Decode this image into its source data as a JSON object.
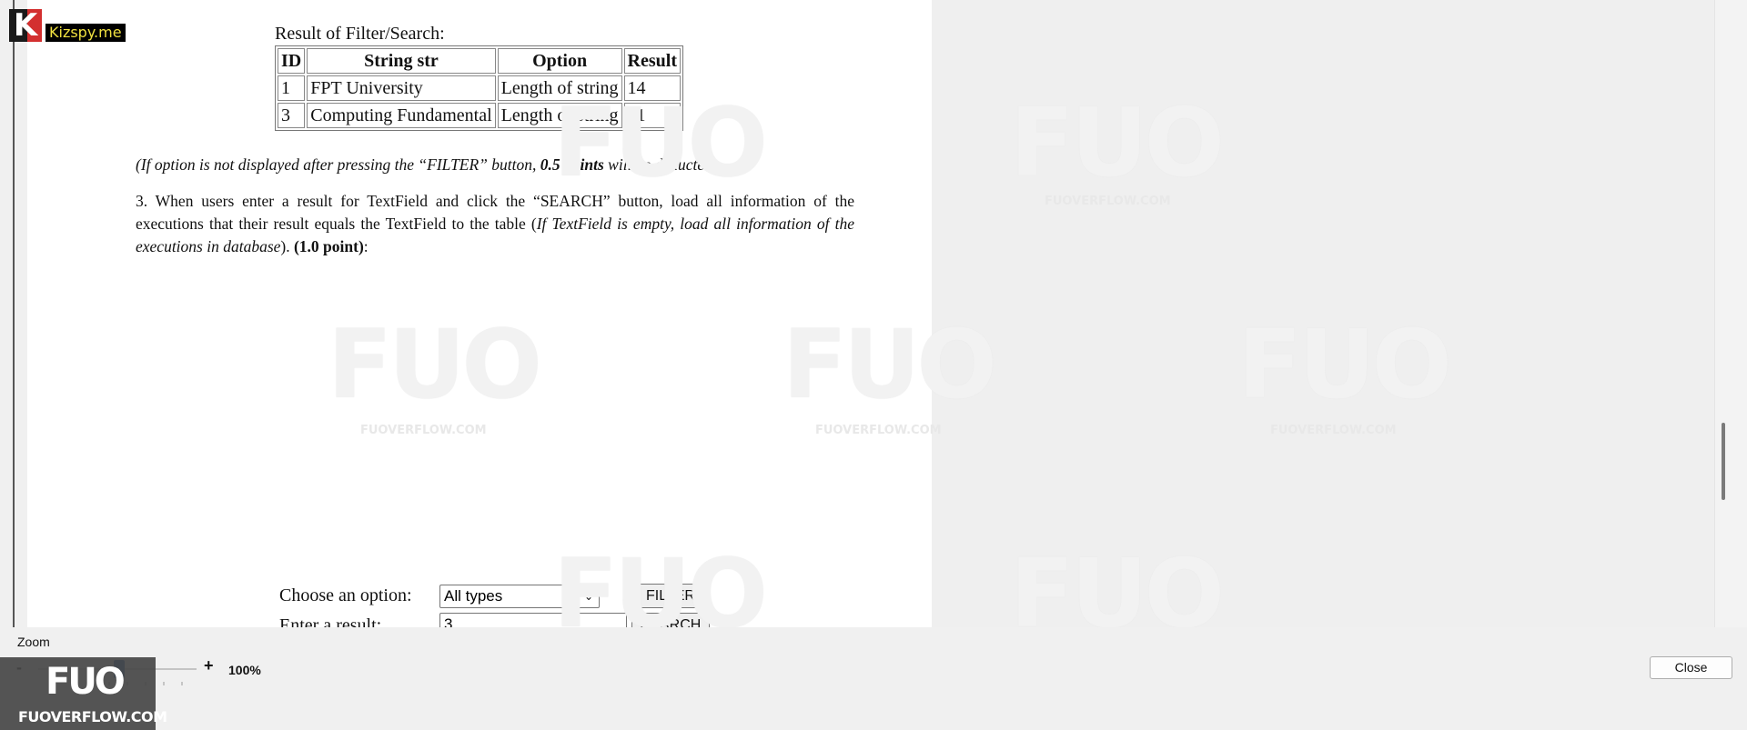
{
  "logo": {
    "mark": "K",
    "text": "Kizspy.me"
  },
  "document": {
    "result_caption": "Result of Filter/Search:",
    "table": {
      "headers": [
        "ID",
        "String str",
        "Option",
        "Result"
      ],
      "rows": [
        [
          "1",
          "FPT University",
          "Length of string",
          "14"
        ],
        [
          "3",
          "Computing Fundamental",
          "Length of string",
          "21"
        ]
      ]
    },
    "note": {
      "part1": "(If option is not displayed after pressing the “FILTER” button, ",
      "bold": "0.5 points",
      "part2": " will be deducted)"
    },
    "paragraph": {
      "text1": "3. When users enter a result for TextField and click the “SEARCH” button, load all information of the executions that their result equals the TextField to the table (",
      "italic": "If TextField is empty, load all information of the executions in database",
      "text2": "). ",
      "bold": "(1.0 point)",
      "text3": ":"
    },
    "form": {
      "option_label": "Choose an option:",
      "option_value": "All types",
      "filter_label": "FILTER",
      "result_label": "Enter a result:",
      "result_value": "3",
      "search_label": "SEARCH"
    }
  },
  "watermark": {
    "mark": "FUO",
    "caption": "FUOVERFLOW.COM"
  },
  "zoom": {
    "label": "Zoom",
    "minus": "-",
    "plus": "+",
    "value": "100%",
    "level_percent": 100
  },
  "close_label": "Close",
  "fuo_logo": {
    "mark": "FUO",
    "name": "FUOVERFLOW.COM"
  },
  "colors": {
    "slider_thumb": "#1c5fa8",
    "logo_red": "#d32f2f",
    "logo_text": "#f0e040"
  }
}
